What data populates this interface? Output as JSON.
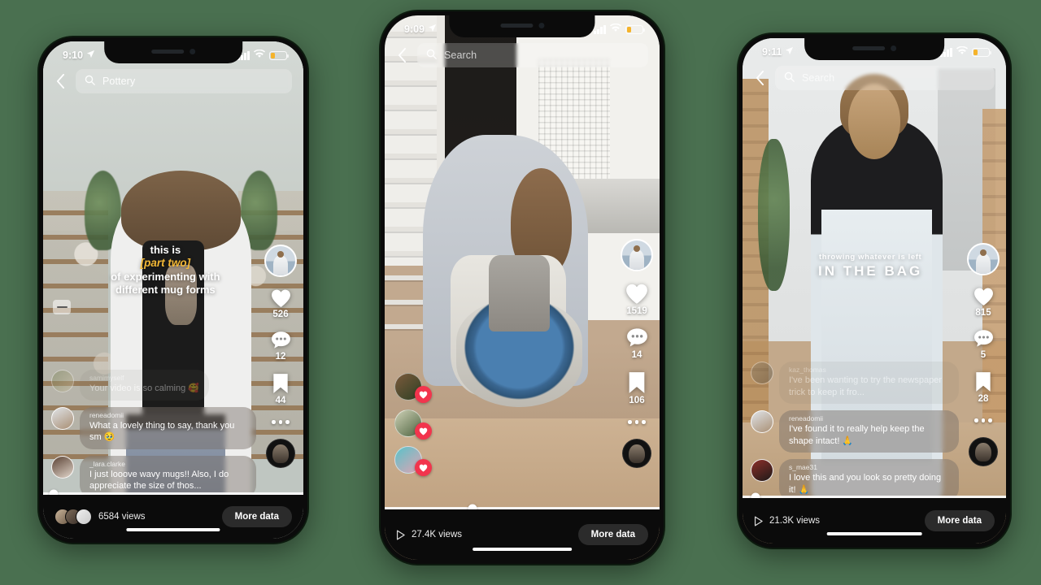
{
  "background_color": "#4a7050",
  "phones": [
    {
      "id": "phone-1",
      "status": {
        "time": "9:10",
        "location_icon": "location-arrow-icon",
        "signal_icon": "cellular-bars-icon",
        "wifi_icon": "wifi-icon",
        "battery_icon": "battery-low-icon"
      },
      "search": {
        "back_icon": "chevron-left-icon",
        "search_icon": "search-icon",
        "value": "Pottery",
        "placeholder": "Search"
      },
      "caption": {
        "line1": "this is",
        "highlight": "[part two]",
        "line3": "of experimenting with",
        "line4": "different mug forms",
        "highlight_color": "#f2b735"
      },
      "rail": {
        "avatar_name": "creator-avatar",
        "like": {
          "icon": "heart-icon",
          "count": "526"
        },
        "comment": {
          "icon": "comment-bubble-icon",
          "count": "12"
        },
        "save": {
          "icon": "bookmark-icon",
          "count": "44"
        },
        "more": {
          "icon": "ellipsis-icon"
        },
        "sound": {
          "icon": "sound-disc-icon"
        }
      },
      "comments": [
        {
          "user": "samimyself",
          "text": "Your video is so calming 🥰",
          "ghost": true
        },
        {
          "user": "reneadomii",
          "text": "What a lovely thing to say, thank you sm 🥹",
          "ghost": false
        },
        {
          "user": "_lara.clarke",
          "text": "I just looove wavy mugs!! Also, I do appreciate the size of thos...",
          "ghost": false
        }
      ],
      "caption_toggle_icon": "closed-captions-icon",
      "bottom": {
        "play_icon": "play-icon",
        "views": "6584 views",
        "more_data_label": "More data"
      },
      "progress_percent": 4
    },
    {
      "id": "phone-2",
      "status": {
        "time": "9:09",
        "location_icon": "location-arrow-icon",
        "signal_icon": "cellular-bars-icon",
        "wifi_icon": "wifi-icon",
        "battery_icon": "battery-low-icon"
      },
      "search": {
        "back_icon": "chevron-left-icon",
        "search_icon": "search-icon",
        "value": "",
        "placeholder": "Search"
      },
      "rail": {
        "avatar_name": "creator-avatar",
        "like": {
          "icon": "heart-icon",
          "count": "1519"
        },
        "comment": {
          "icon": "comment-bubble-icon",
          "count": "14"
        },
        "save": {
          "icon": "bookmark-icon",
          "count": "106"
        },
        "more": {
          "icon": "ellipsis-icon"
        },
        "sound": {
          "icon": "sound-disc-icon"
        }
      },
      "reactions": [
        {
          "name": "reaction-avatar-1",
          "badge_icon": "heart-icon",
          "badge_color": "#f2344d"
        },
        {
          "name": "reaction-avatar-2",
          "badge_icon": "heart-icon",
          "badge_color": "#f2344d"
        },
        {
          "name": "reaction-avatar-3",
          "badge_icon": "heart-icon",
          "badge_color": "#f2344d"
        }
      ],
      "bottom": {
        "play_icon": "play-icon",
        "views": "27.4K views",
        "more_data_label": "More data"
      },
      "progress_percent": 32
    },
    {
      "id": "phone-3",
      "status": {
        "time": "9:11",
        "location_icon": "location-arrow-icon",
        "signal_icon": "cellular-bars-icon",
        "wifi_icon": "wifi-icon",
        "battery_icon": "battery-low-icon"
      },
      "search": {
        "back_icon": "chevron-left-icon",
        "search_icon": "search-icon",
        "value": "",
        "placeholder": "Search"
      },
      "caption": {
        "small": "throwing whatever is left",
        "big": "IN THE BAG"
      },
      "rail": {
        "avatar_name": "creator-avatar",
        "like": {
          "icon": "heart-icon",
          "count": "815"
        },
        "comment": {
          "icon": "comment-bubble-icon",
          "count": "5"
        },
        "save": {
          "icon": "bookmark-icon",
          "count": "28"
        },
        "more": {
          "icon": "ellipsis-icon"
        },
        "sound": {
          "icon": "sound-disc-icon"
        }
      },
      "comments": [
        {
          "user": "kaz_thomas",
          "text": "I've been wanting to try the newspaper trick to keep it fro...",
          "ghost": true
        },
        {
          "user": "reneadomii",
          "text": "I've found it to really help keep the shape intact! 🙏",
          "ghost": false
        },
        {
          "user": "s_mae31",
          "text": "I love this and you look so pretty doing it! 🙏",
          "ghost": false
        }
      ],
      "bottom": {
        "play_icon": "play-icon",
        "views": "21.3K views",
        "more_data_label": "More data"
      },
      "progress_percent": 5
    }
  ]
}
